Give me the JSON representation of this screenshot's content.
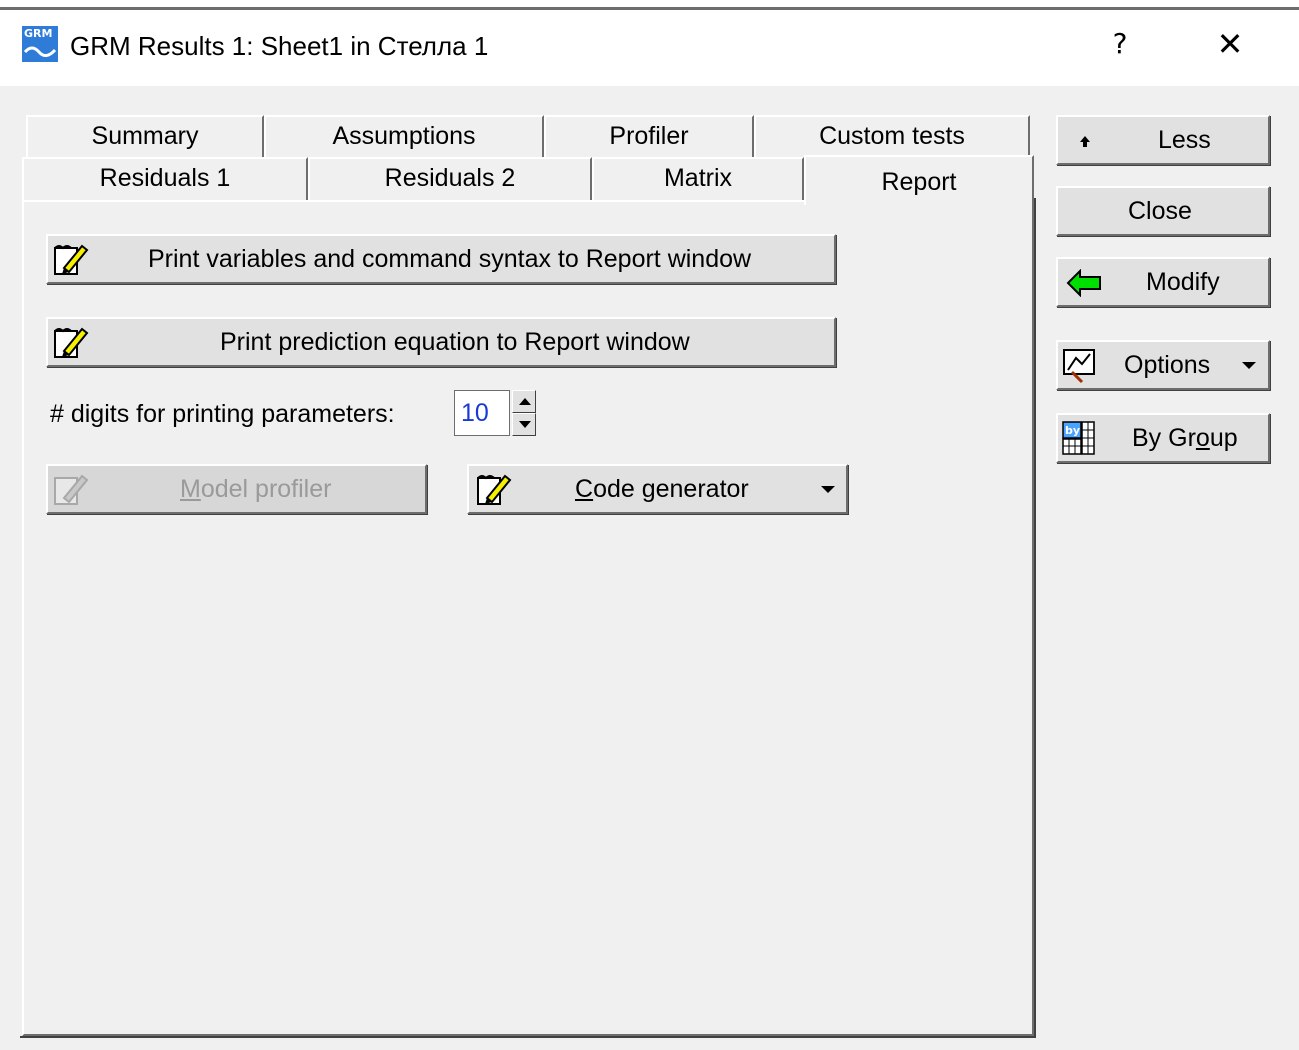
{
  "window": {
    "title": "GRM Results 1: Sheet1 in Стелла 1",
    "app_icon_text": "GRM",
    "help_label": "?",
    "close_label": "✕"
  },
  "tabs": {
    "row1": [
      "Summary",
      "Assumptions",
      "Profiler",
      "Custom tests"
    ],
    "row2": [
      "Residuals 1",
      "Residuals 2",
      "Matrix",
      "Report"
    ],
    "active": "Report"
  },
  "report": {
    "print_vars_label": "Print variables and command syntax to Report window",
    "print_eq_label": "Print prediction equation to Report window",
    "digits_label": "# digits for printing parameters:",
    "digits_value": "10",
    "model_profiler_prefix": "M",
    "model_profiler_rest": "odel profiler",
    "code_gen_prefix": "C",
    "code_gen_rest": "ode generator"
  },
  "side_buttons": {
    "less_label": "Less",
    "close_label": "Close",
    "modify_label": "Modify",
    "options_label": "Options",
    "bygroup_pre": "By Gr",
    "bygroup_ul": "o",
    "bygroup_post": "up"
  },
  "icons": {
    "pen": "pencil-notepad-icon",
    "less": "up-arrow-icon",
    "modify": "green-back-arrow-icon",
    "options": "options-icon",
    "bygroup": "by-group-icon"
  },
  "colors": {
    "window_bg": "#f0f0f0",
    "titlebar_bg": "#ffffff",
    "spin_value": "#1a38d6",
    "modify_arrow": "#00e000"
  }
}
